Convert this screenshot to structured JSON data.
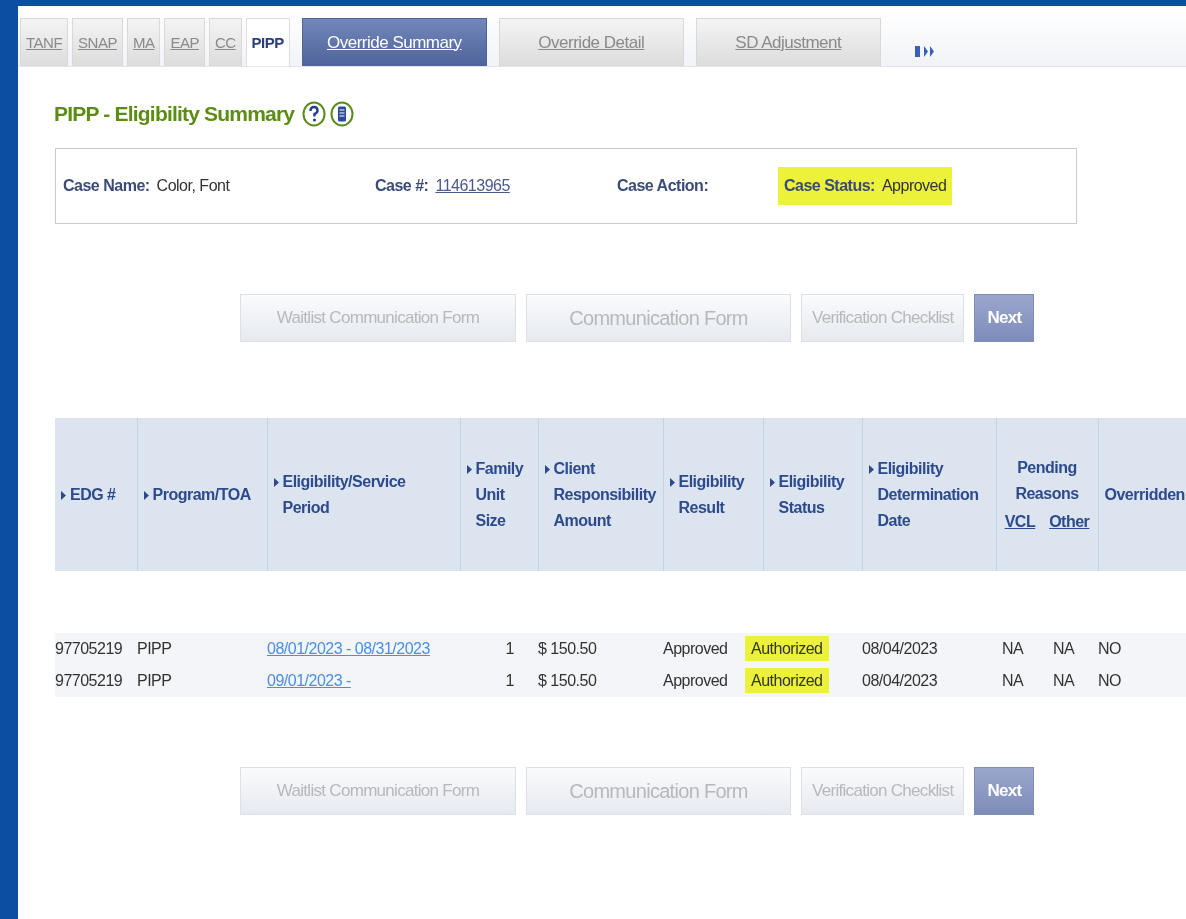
{
  "tabs": [
    {
      "label": "TANF",
      "selected": false,
      "kind": "small"
    },
    {
      "label": "SNAP",
      "selected": false,
      "kind": "small"
    },
    {
      "label": "MA",
      "selected": false,
      "kind": "small"
    },
    {
      "label": "EAP",
      "selected": false,
      "kind": "small"
    },
    {
      "label": "CC",
      "selected": false,
      "kind": "small"
    },
    {
      "label": "PIPP",
      "selected": true,
      "kind": "small"
    },
    {
      "label": "Override Summary",
      "selected": true,
      "kind": "wide"
    },
    {
      "label": "Override Detail",
      "selected": false,
      "kind": "wide"
    },
    {
      "label": "SD Adjustment",
      "selected": false,
      "kind": "wide"
    }
  ],
  "page_title": "PIPP - Eligibility Summary",
  "case_info": [
    {
      "label": "Case Name:",
      "value": "Color, Font",
      "kind": "text",
      "highlighted": false
    },
    {
      "label": "Case #:",
      "value": "114613965",
      "kind": "link",
      "highlighted": false
    },
    {
      "label": "Case Action:",
      "highlighted": false
    },
    {
      "label": "Case Status:",
      "value": "Approved",
      "kind": "text",
      "highlighted": true
    }
  ],
  "top_buttons": [
    {
      "label": "Waitlist Communication Form",
      "disabled": true,
      "kind": "plain"
    },
    {
      "label": "Communication Form",
      "disabled": true,
      "kind": "large"
    },
    {
      "label": "Verification Checklist",
      "disabled": true,
      "kind": "plain"
    },
    {
      "label": "Next",
      "disabled": false,
      "kind": "plain"
    }
  ],
  "table": {
    "columns": [
      {
        "label": "EDG #",
        "sortable": true
      },
      {
        "label": "Program/TOA",
        "sortable": true
      },
      {
        "label": "Eligibility/Service Period",
        "sortable": true
      },
      {
        "label": "Family Unit Size",
        "sortable": true
      },
      {
        "label": "Client Responsibility Amount",
        "sortable": true
      },
      {
        "label": "Eligibility Result",
        "sortable": true
      },
      {
        "label": "Eligibility Status",
        "sortable": true
      },
      {
        "label": "Eligibility Determination Date",
        "sortable": true
      },
      {
        "label": "Pending Reasons",
        "sortable": false,
        "colspan": 2,
        "subcolumns": [
          "VCL",
          "Other"
        ]
      },
      {
        "label": "Overridden",
        "sortable": false
      }
    ],
    "rows": [
      {
        "cells": [
          "97705219",
          "PIPP",
          "08/01/2023 - 08/31/2023",
          "1",
          "$ 150.50",
          "Approved",
          "Authorized",
          "08/04/2023",
          "NA",
          "NA",
          "NO"
        ],
        "status_highlighted": true
      },
      {
        "cells": [
          "97705219",
          "PIPP",
          "09/01/2023 -",
          "1",
          "$ 150.50",
          "Approved",
          "Authorized",
          "08/04/2023",
          "NA",
          "NA",
          "NO"
        ],
        "status_highlighted": true
      }
    ]
  },
  "bottom_buttons": [
    {
      "label": "Waitlist Communication Form",
      "disabled": true,
      "kind": "plain"
    },
    {
      "label": "Communication Form",
      "disabled": true,
      "kind": "large"
    },
    {
      "label": "Verification Checklist",
      "disabled": true,
      "kind": "plain"
    },
    {
      "label": "Next",
      "disabled": false,
      "kind": "plain"
    }
  ]
}
